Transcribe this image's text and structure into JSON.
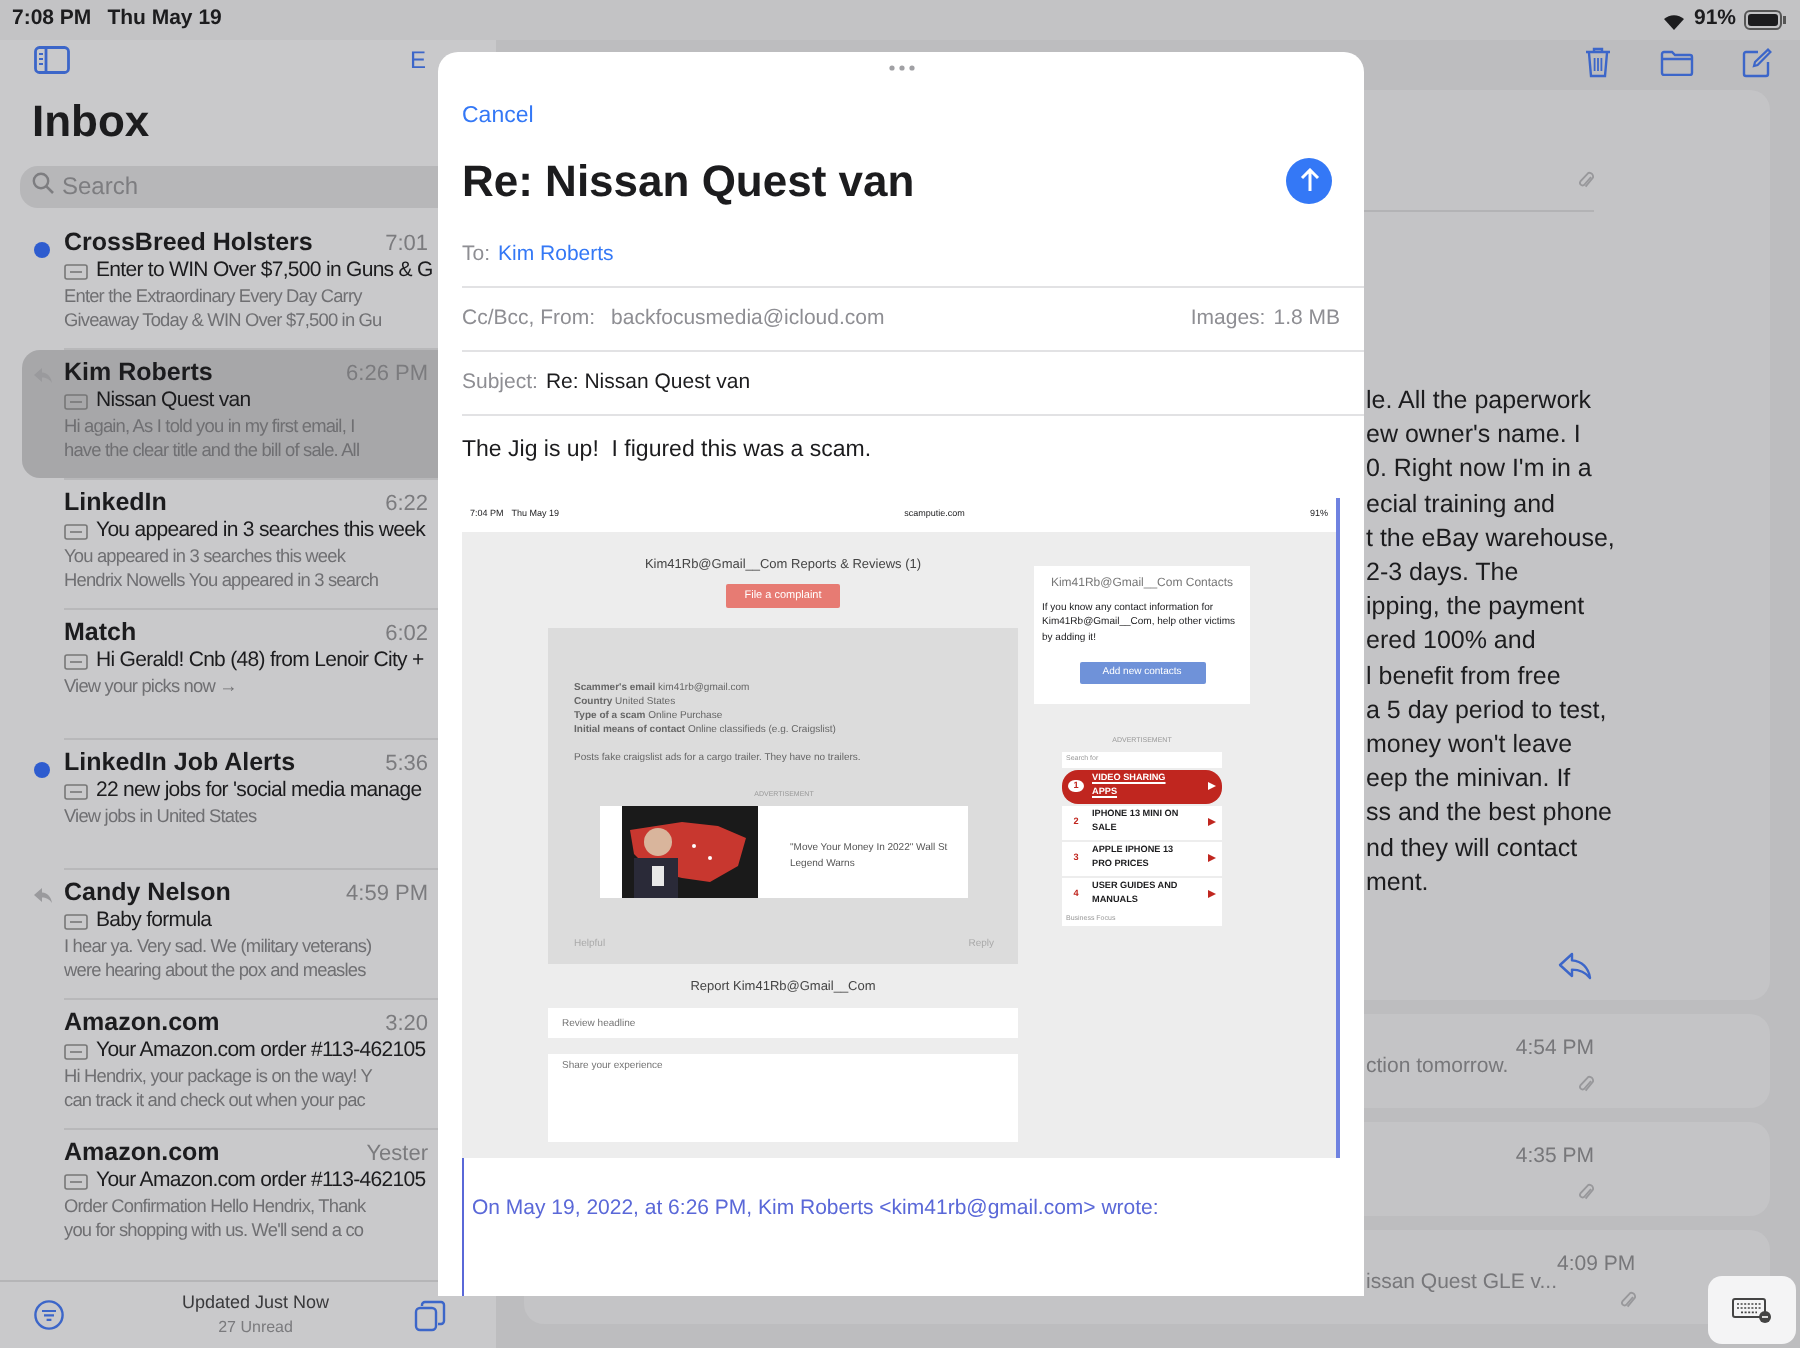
{
  "status_bar": {
    "time": "7:08 PM",
    "date": "Thu May 19",
    "battery": "91%"
  },
  "sidebar": {
    "edit": "E",
    "title": "Inbox",
    "search_placeholder": "Search",
    "messages": [
      {
        "sender": "CrossBreed Holsters",
        "time": "7:01",
        "subject": "Enter to WIN Over $7,500 in Guns & G",
        "preview": [
          "Enter the Extraordinary Every Day Carry",
          "Giveaway Today & WIN Over $7,500 in Gu"
        ],
        "unread": true,
        "replied": false,
        "selected": false
      },
      {
        "sender": "Kim Roberts",
        "time": "6:26 PM",
        "subject": "Nissan Quest van",
        "preview": [
          "Hi again, As I told you in my first email, I",
          "have the clear title and the bill of sale. All"
        ],
        "unread": false,
        "replied": true,
        "selected": true
      },
      {
        "sender": "LinkedIn",
        "time": "6:22",
        "subject": "You appeared in 3 searches this week",
        "preview": [
          "You appeared in 3 searches this week",
          "Hendrix Nowells You appeared in 3 search"
        ],
        "unread": false,
        "replied": false,
        "selected": false
      },
      {
        "sender": "Match",
        "time": "6:02",
        "subject": "Hi Gerald! Cnb (48) from Lenoir City +",
        "preview": [
          "View your picks now →"
        ],
        "unread": false,
        "replied": false,
        "selected": false
      },
      {
        "sender": "LinkedIn Job Alerts",
        "time": "5:36",
        "subject": "22 new jobs for 'social media manage",
        "preview": [
          "View jobs in United States"
        ],
        "unread": true,
        "replied": false,
        "selected": false
      },
      {
        "sender": "Candy Nelson",
        "time": "4:59 PM",
        "subject": "Baby formula",
        "preview": [
          "I hear ya. Very sad. We (military veterans)",
          "were hearing about the pox and measles"
        ],
        "unread": false,
        "replied": true,
        "selected": false
      },
      {
        "sender": "Amazon.com",
        "time": "3:20",
        "subject": "Your Amazon.com order #113-462105",
        "preview": [
          "Hi Hendrix, your package is on the way! Y",
          "can track it and check out when your pac"
        ],
        "unread": false,
        "replied": false,
        "selected": false
      },
      {
        "sender": "Amazon.com",
        "time": "Yester",
        "subject": "Your Amazon.com order #113-462105",
        "preview": [
          "Order Confirmation Hello Hendrix, Thank",
          "you for shopping with us. We'll send a co"
        ],
        "unread": false,
        "replied": false,
        "selected": false
      }
    ],
    "footer": {
      "updated": "Updated Just Now",
      "unread": "27 Unread"
    }
  },
  "thread": {
    "cards": [
      {
        "kind": "expanded",
        "body_lines": [
          "le. All the paperwork",
          "ew owner's name. I",
          "0. Right now I'm in a",
          "ecial training and",
          "t the eBay warehouse,",
          "2-3 days. The",
          "ipping, the payment",
          "ered 100% and",
          "l benefit from free",
          "a 5 day period to test,",
          "money won't leave",
          "eep the minivan. If",
          "ss and the best phone",
          "nd they will contact",
          "ment."
        ]
      },
      {
        "kind": "collapsed",
        "time": "4:54 PM",
        "snippet": "ction tomorrow."
      },
      {
        "kind": "collapsed",
        "time": "4:35 PM"
      },
      {
        "kind": "collapsed",
        "time": "4:09 PM",
        "snippet": "issan Quest GLE v..."
      }
    ]
  },
  "compose": {
    "cancel": "Cancel",
    "title": "Re: Nissan Quest van",
    "to_label": "To:",
    "to": "Kim Roberts",
    "from_label": "Cc/Bcc, From:",
    "from": "backfocusmedia@icloud.com",
    "images_label": "Images:",
    "images_size": "1.8 MB",
    "subject_label": "Subject:",
    "subject": "Re: Nissan Quest van",
    "body": "The Jig is up!  I figured this was a scam.",
    "attachment": {
      "status_time": "7:04 PM",
      "status_date": "Thu May 19",
      "url": "scamputie.com",
      "battery": "91%",
      "heading": "Kim41Rb@Gmail__Com Reports & Reviews (1)",
      "complaint_button": "File a complaint",
      "report": {
        "fields": [
          "**Scammer's email** kim41rb@gmail.com",
          "**Country** United States",
          "**Type of a scam** Online Purchase",
          "**Initial means of contact** Online classifieds (e.g. Craigslist)"
        ],
        "text": "Posts fake craigslist ads for a cargo trailer. They have no trailers.",
        "ad_label": "ADVERTISEMENT",
        "ad_text": "\"Move Your Money In 2022\" Wall St Legend Warns",
        "helpful": "Helpful",
        "reply": "Reply"
      },
      "form_heading": "Report Kim41Rb@Gmail__Com",
      "headline_placeholder": "Review headline",
      "experience_placeholder": "Share your experience",
      "contacts": {
        "title": "Kim41Rb@Gmail__Com Contacts",
        "text": "If you know any contact information for Kim41Rb@Gmail__Com, help other victims by adding it!",
        "button": "Add new contacts"
      },
      "ad_label": "ADVERTISEMENT",
      "search_label": "Search for",
      "ad_items": [
        {
          "number": "1",
          "text": "VIDEO SHARING APPS",
          "selected": true
        },
        {
          "number": "2",
          "text": "IPHONE 13 MINI ON SALE",
          "selected": false
        },
        {
          "number": "3",
          "text": "APPLE IPHONE 13 PRO PRICES",
          "selected": false
        },
        {
          "number": "4",
          "text": "USER GUIDES AND MANUALS",
          "selected": false
        }
      ],
      "ad_footer": "Business Focus"
    },
    "quote_header": "On May 19, 2022, at 6:26 PM, Kim Roberts <kim41rb@gmail.com> wrote:"
  }
}
